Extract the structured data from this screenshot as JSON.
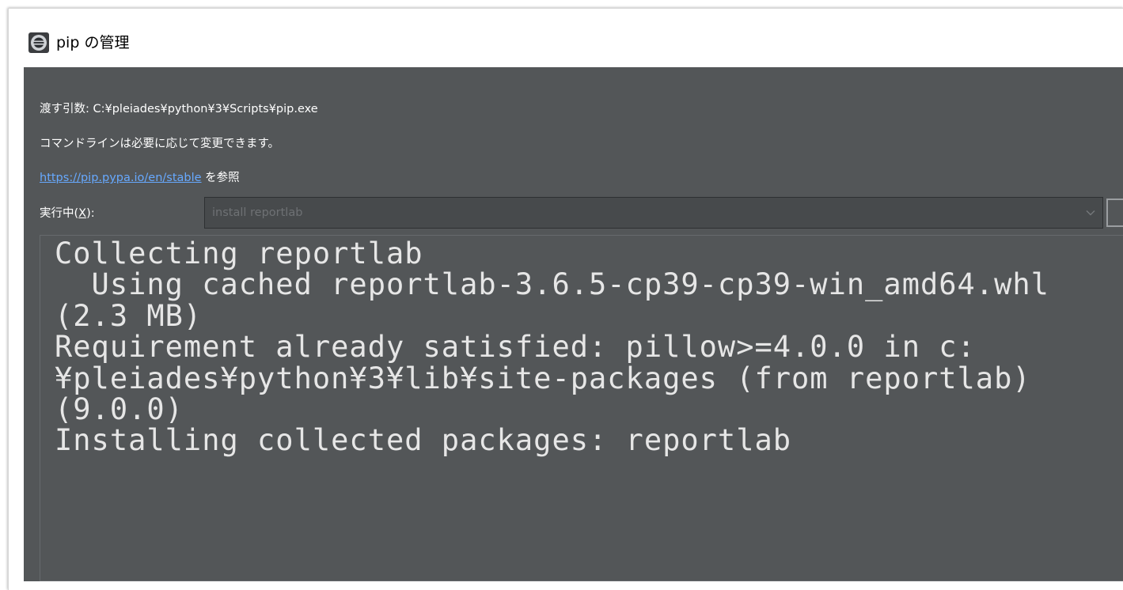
{
  "window": {
    "title": "pip の管理",
    "icon": "eclipse-icon"
  },
  "info": {
    "args_line": "渡す引数: C:¥pleiades¥python¥3¥Scripts¥pip.exe",
    "note_line": "コマンドラインは必要に応じて変更できます。",
    "link_text": "https://pip.pypa.io/en/stable",
    "link_suffix": " を参照"
  },
  "run": {
    "label_prefix": "実行中(",
    "label_mnemonic": "X",
    "label_suffix": "):",
    "command_value": "install reportlab",
    "dropdown_icon": "chevron-down-icon"
  },
  "console": {
    "lines": [
      "Collecting reportlab",
      "  Using cached reportlab-3.6.5-cp39-cp39-win_amd64.whl",
      "(2.3 MB)",
      "Requirement already satisfied: pillow>=4.0.0 in c:",
      "¥pleiades¥python¥3¥lib¥site-packages (from reportlab)",
      "(9.0.0)",
      "Installing collected packages: reportlab"
    ]
  },
  "colors": {
    "panel_background": "#535658",
    "console_text": "#e6e6e6",
    "link": "#67a9ff",
    "combo_background": "#474a4c"
  }
}
